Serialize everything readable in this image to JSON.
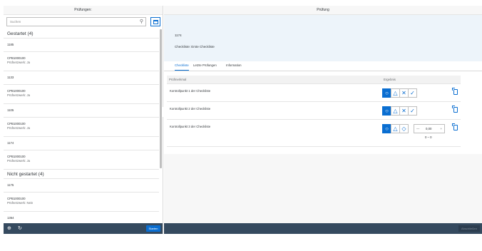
{
  "master": {
    "title": "Prüfungen:",
    "search_placeholder": "Suchen",
    "groups": [
      {
        "label": "Gestartet (4)",
        "items": [
          {
            "title": "1185",
            "lines": []
          },
          {
            "title": "CPB1000100",
            "lines": [
              "Prüfnetzwerk: Ja"
            ]
          },
          {
            "title": "1133",
            "lines": []
          },
          {
            "title": "CPB1000100",
            "lines": [
              "Prüfnetzwerk: Ja"
            ]
          },
          {
            "title": "1105",
            "lines": []
          },
          {
            "title": "CPB1000100",
            "lines": [
              "Prüfnetzwerk: Ja"
            ]
          },
          {
            "title": "1174",
            "lines": []
          },
          {
            "title": "CPB1000100",
            "lines": [
              "Prüfnetzwerk: Ja"
            ]
          }
        ]
      },
      {
        "label": "Nicht gestartet (4)",
        "items": [
          {
            "title": "1175",
            "lines": []
          },
          {
            "title": "CPB1000100",
            "lines": [
              "Prüfnetzwerk: Nein"
            ]
          },
          {
            "title": "1364",
            "lines": []
          }
        ]
      }
    ],
    "footer_button": "Starten"
  },
  "detail": {
    "title": "Prüfung",
    "object_id": "1174",
    "checklist_label": "Checkliste: Erste Checkliste",
    "tabs": [
      "Checkliste",
      "Letzte Prüfungen",
      "Information"
    ],
    "columns": [
      "Prüfmerkmal",
      "Ergebnis"
    ],
    "rows": [
      {
        "label": "Kontrollpunkt 1 der Checkliste"
      },
      {
        "label": "Kontrollpunkt 2 der Checkliste"
      },
      {
        "label": "Kontrollpunkt 3 der Checkliste",
        "stepper_value": "0,00",
        "range": "0 – 0"
      }
    ],
    "footer_button": "Abschließen"
  },
  "colors": {
    "accent": "#0a6ed1",
    "shell": "#354a5f",
    "header_bg": "#edf4fa"
  }
}
